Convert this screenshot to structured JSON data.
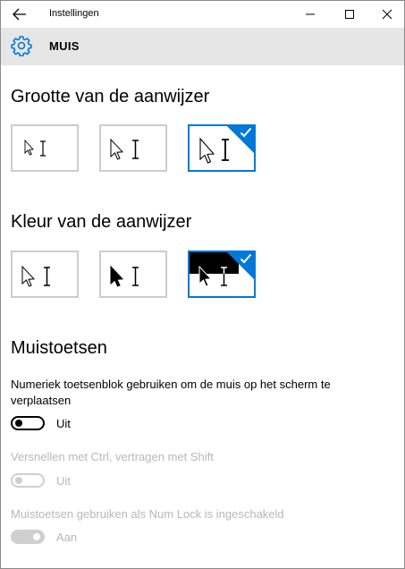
{
  "window": {
    "title": "Instellingen"
  },
  "header": {
    "title": "MUIS",
    "icon": "gear-icon"
  },
  "pointer_size": {
    "title": "Grootte van de aanwijzer",
    "options": [
      "small",
      "medium",
      "large"
    ],
    "selected": "large"
  },
  "pointer_color": {
    "title": "Kleur van de aanwijzer",
    "options": [
      "white",
      "black",
      "inverted"
    ],
    "selected": "inverted"
  },
  "mousekeys": {
    "title": "Muistoetsen",
    "setting1": {
      "label": "Numeriek toetsenblok gebruiken om de muis op het scherm te verplaatsen",
      "state": "Uit",
      "enabled": true
    },
    "setting2": {
      "label": "Versnellen met Ctrl, vertragen met Shift",
      "state": "Uit",
      "enabled": false
    },
    "setting3": {
      "label": "Muistoetsen gebruiken als Num Lock is ingeschakeld",
      "state": "Aan",
      "enabled": false
    }
  },
  "colors": {
    "accent": "#0078d7",
    "header_bg": "#e6e6e6",
    "disabled": "#b8b8b8"
  }
}
